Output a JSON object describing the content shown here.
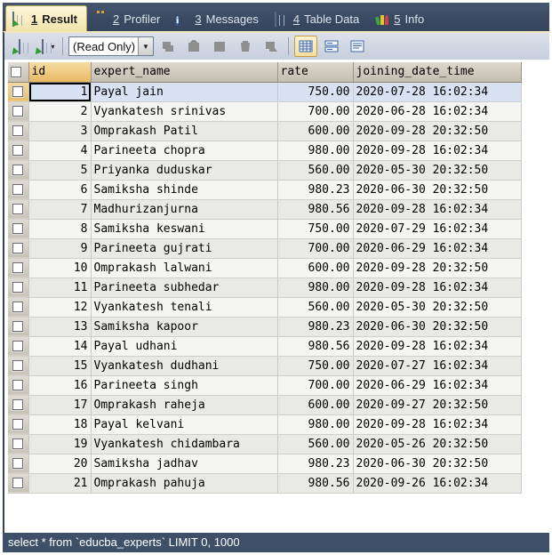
{
  "tabs": {
    "items": [
      {
        "num": "1",
        "text": "Result",
        "icon": "result-grid-icon",
        "active": true
      },
      {
        "num": "2",
        "text": "Profiler",
        "icon": "profiler-gauge-icon",
        "active": false
      },
      {
        "num": "3",
        "text": "Messages",
        "icon": "messages-info-icon",
        "active": false
      },
      {
        "num": "4",
        "text": "Table Data",
        "icon": "table-data-grid-icon",
        "active": false
      },
      {
        "num": "5",
        "text": "Info",
        "icon": "info-books-icon",
        "active": false
      }
    ]
  },
  "toolbar": {
    "read_only_label": "(Read Only)",
    "icons": [
      "insert-grid-icon",
      "grid-options-icon",
      "dropdown-caret-icon",
      "apply-icon",
      "paste-icon",
      "stop-icon",
      "delete-icon",
      "revert-icon",
      "grid-view-icon",
      "form-view-icon",
      "text-view-icon"
    ]
  },
  "table": {
    "columns": [
      {
        "label": "id"
      },
      {
        "label": "expert_name"
      },
      {
        "label": "rate"
      },
      {
        "label": "joining_date_time"
      }
    ],
    "rows": [
      {
        "id": "1",
        "expert_name": "Payal jain",
        "rate": "750.00",
        "joining_date_time": "2020-07-28 16:02:34"
      },
      {
        "id": "2",
        "expert_name": "Vyankatesh srinivas",
        "rate": "700.00",
        "joining_date_time": "2020-06-28 16:02:34"
      },
      {
        "id": "3",
        "expert_name": "Omprakash Patil",
        "rate": "600.00",
        "joining_date_time": "2020-09-28 20:32:50"
      },
      {
        "id": "4",
        "expert_name": "Parineeta chopra",
        "rate": "980.00",
        "joining_date_time": "2020-09-28 16:02:34"
      },
      {
        "id": "5",
        "expert_name": "Priyanka duduskar",
        "rate": "560.00",
        "joining_date_time": "2020-05-30 20:32:50"
      },
      {
        "id": "6",
        "expert_name": "Samiksha shinde",
        "rate": "980.23",
        "joining_date_time": "2020-06-30 20:32:50"
      },
      {
        "id": "7",
        "expert_name": "Madhurizanjurna",
        "rate": "980.56",
        "joining_date_time": "2020-09-28 16:02:34"
      },
      {
        "id": "8",
        "expert_name": "Samiksha keswani",
        "rate": "750.00",
        "joining_date_time": "2020-07-29 16:02:34"
      },
      {
        "id": "9",
        "expert_name": "Parineeta gujrati",
        "rate": "700.00",
        "joining_date_time": "2020-06-29 16:02:34"
      },
      {
        "id": "10",
        "expert_name": "Omprakash lalwani",
        "rate": "600.00",
        "joining_date_time": "2020-09-28 20:32:50"
      },
      {
        "id": "11",
        "expert_name": "Parineeta subhedar",
        "rate": "980.00",
        "joining_date_time": "2020-09-28 16:02:34"
      },
      {
        "id": "12",
        "expert_name": "Vyankatesh tenali",
        "rate": "560.00",
        "joining_date_time": "2020-05-30 20:32:50"
      },
      {
        "id": "13",
        "expert_name": "Samiksha kapoor",
        "rate": "980.23",
        "joining_date_time": "2020-06-30 20:32:50"
      },
      {
        "id": "14",
        "expert_name": "Payal udhani",
        "rate": "980.56",
        "joining_date_time": "2020-09-28 16:02:34"
      },
      {
        "id": "15",
        "expert_name": "Vyankatesh dudhani",
        "rate": "750.00",
        "joining_date_time": "2020-07-27 16:02:34"
      },
      {
        "id": "16",
        "expert_name": "Parineeta singh",
        "rate": "700.00",
        "joining_date_time": "2020-06-29 16:02:34"
      },
      {
        "id": "17",
        "expert_name": "Omprakash raheja",
        "rate": "600.00",
        "joining_date_time": "2020-09-27 20:32:50"
      },
      {
        "id": "18",
        "expert_name": "Payal kelvani",
        "rate": "980.00",
        "joining_date_time": "2020-09-28 16:02:34"
      },
      {
        "id": "19",
        "expert_name": "Vyankatesh chidambara",
        "rate": "560.00",
        "joining_date_time": "2020-05-26 20:32:50"
      },
      {
        "id": "20",
        "expert_name": "Samiksha jadhav",
        "rate": "980.23",
        "joining_date_time": "2020-06-30 20:32:50"
      },
      {
        "id": "21",
        "expert_name": "Omprakash pahuja",
        "rate": "980.56",
        "joining_date_time": "2020-09-26 16:02:34"
      }
    ]
  },
  "status": {
    "query": "select * from `educba_experts` LIMIT 0, 1000"
  },
  "colors": {
    "tabbar_bg": "#3a4962",
    "active_tab_bg": "#f6e8ba",
    "selected_row": "#d8e2f2",
    "selected_header": "#e9b763",
    "status_bar": "#3e5068"
  }
}
